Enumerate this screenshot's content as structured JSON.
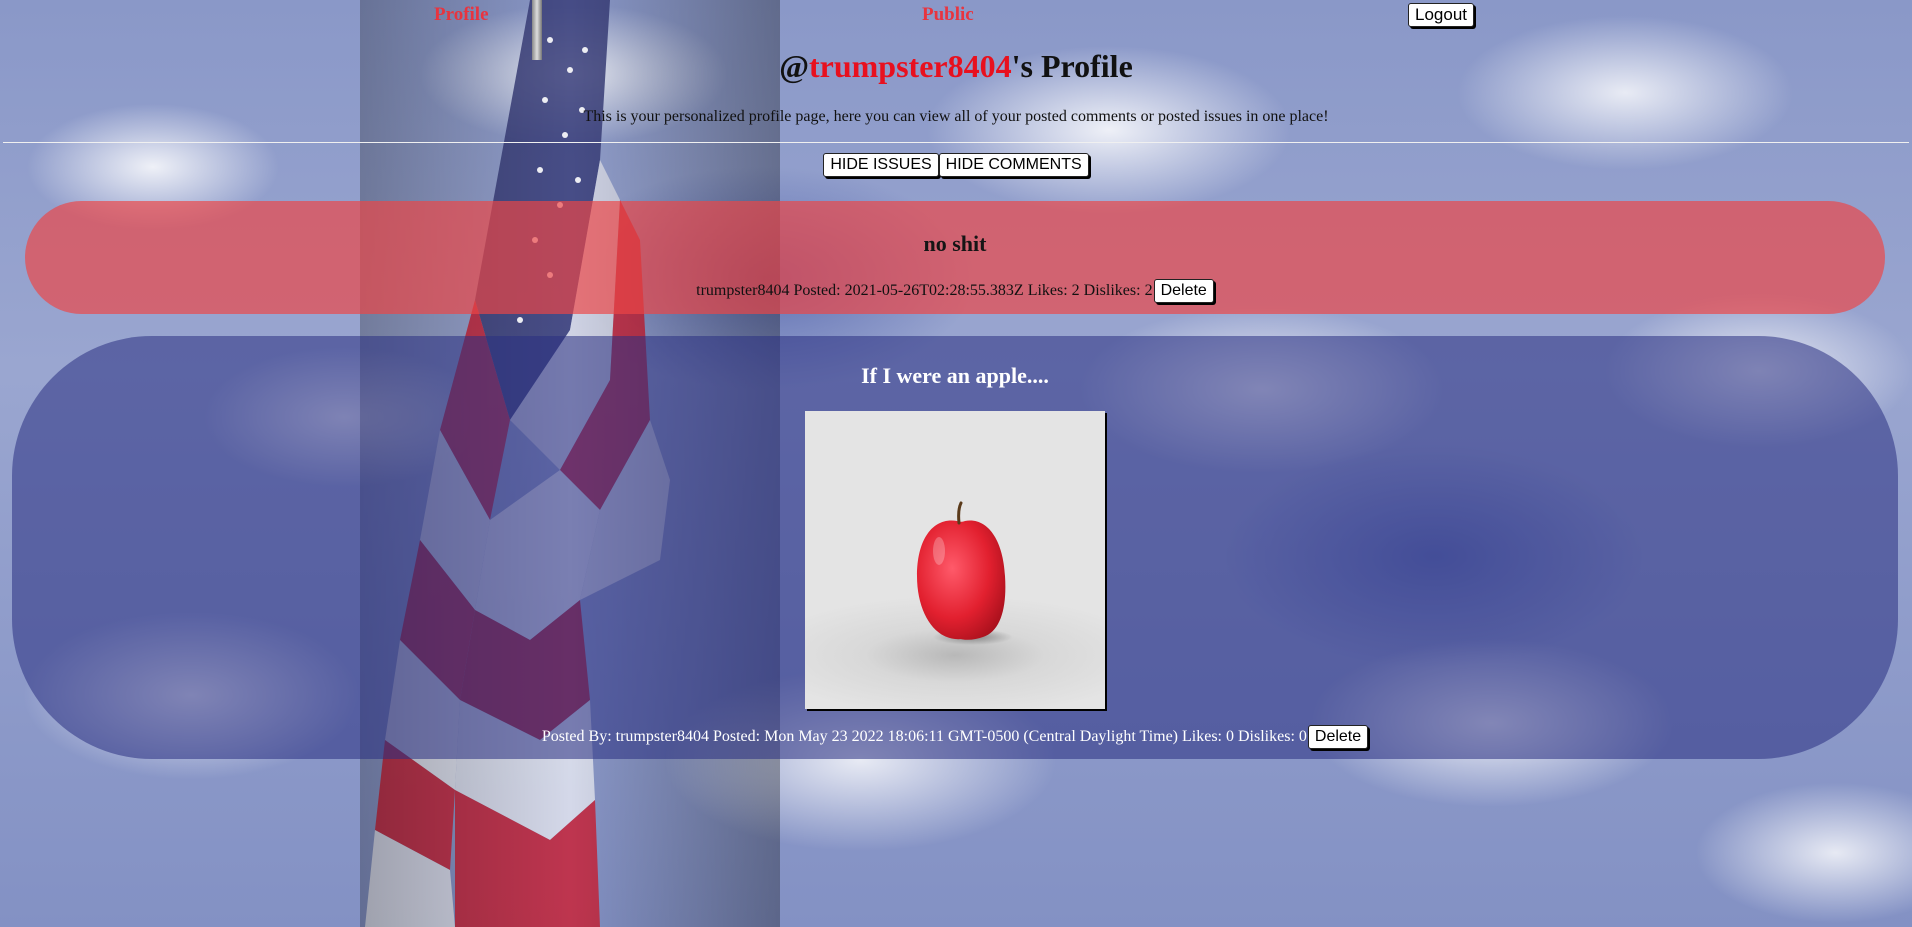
{
  "nav": {
    "profile_label": "Profile",
    "public_label": "Public",
    "logout_label": "Logout"
  },
  "header": {
    "prefix": "@",
    "username": "trumpster8404",
    "suffix": "'s Profile",
    "description": "This is your personalized profile page, here you can view all of your posted comments or posted issues in one place!"
  },
  "toggles": {
    "hide_issues_label": "HIDE ISSUES",
    "hide_comments_label": "HIDE COMMENTS"
  },
  "issue": {
    "title": "no shit",
    "meta": "trumpster8404 Posted: 2021-05-26T02:28:55.383Z Likes: 2 Dislikes: 2",
    "delete_label": "Delete"
  },
  "post": {
    "title": "If I were an apple....",
    "image_alt": "apple",
    "meta": "Posted By: trumpster8404 Posted: Mon May 23 2022 18:06:11 GMT-0500 (Central Daylight Time) Likes: 0 Dislikes: 0",
    "delete_label": "Delete"
  },
  "colors": {
    "accent_red": "#e8343f",
    "username_red": "#e8101e",
    "issue_card": "rgba(238,70,70,0.68)",
    "post_card": "rgba(42,48,130,0.55)"
  }
}
